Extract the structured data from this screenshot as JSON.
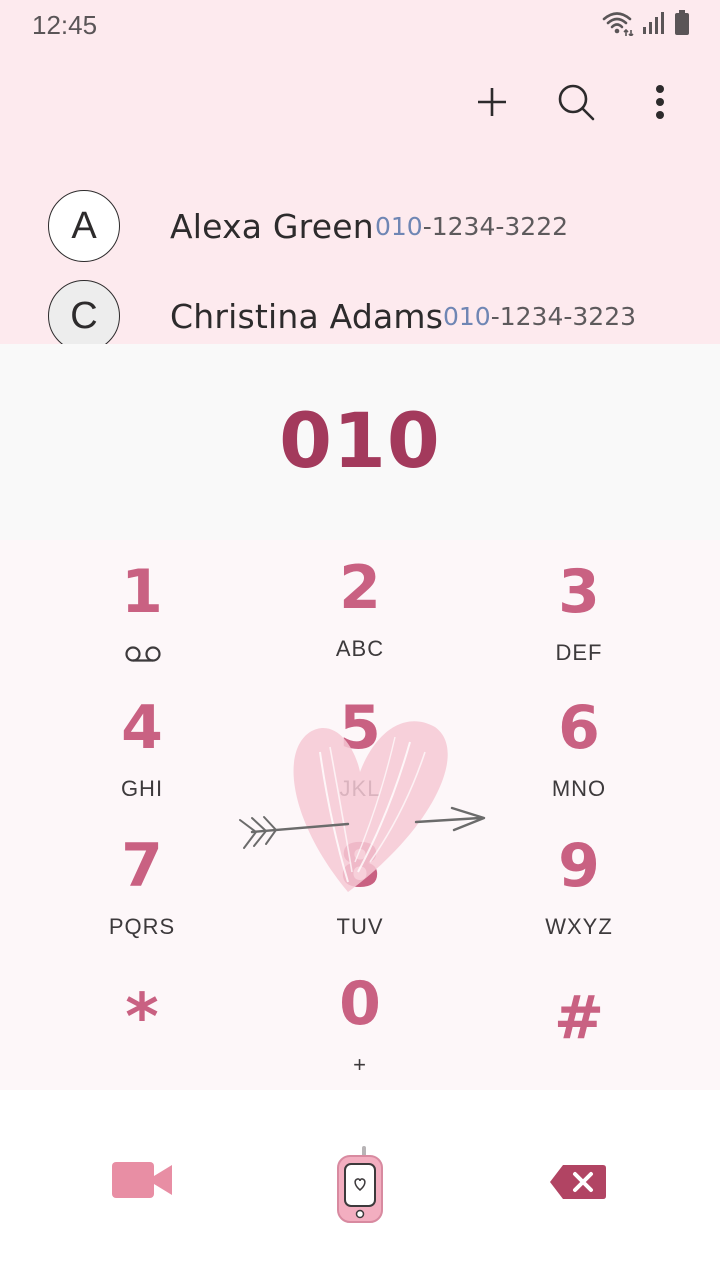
{
  "status_bar": {
    "time": "12:45",
    "icons": [
      "wifi-icon",
      "signal-icon",
      "battery-icon"
    ]
  },
  "toolbar": {
    "actions": [
      "add-contact-icon",
      "search-icon",
      "more-options-icon"
    ]
  },
  "contacts": [
    {
      "initial": "A",
      "name": "Alexa Green",
      "number_match": "010",
      "number_rest": "-1234-3222"
    },
    {
      "initial": "C",
      "name": "Christina Adams",
      "number_match": "010",
      "number_rest": "-1234-3223"
    }
  ],
  "dialer": {
    "entered_number": "010"
  },
  "keypad": {
    "keys": [
      {
        "digit": "1",
        "letters": "",
        "sub_icon": "voicemail-icon"
      },
      {
        "digit": "2",
        "letters": "ABC"
      },
      {
        "digit": "3",
        "letters": "DEF"
      },
      {
        "digit": "4",
        "letters": "GHI"
      },
      {
        "digit": "5",
        "letters": "JKL"
      },
      {
        "digit": "6",
        "letters": "MNO"
      },
      {
        "digit": "7",
        "letters": "PQRS"
      },
      {
        "digit": "8",
        "letters": "TUV"
      },
      {
        "digit": "9",
        "letters": "WXYZ"
      },
      {
        "digit": "*",
        "letters": ""
      },
      {
        "digit": "0",
        "letters": "+"
      },
      {
        "digit": "#",
        "letters": ""
      }
    ]
  },
  "bottom_bar": {
    "actions": [
      "video-call-icon",
      "call-button-phone-icon",
      "backspace-icon"
    ]
  },
  "colors": {
    "accent": "#c96182",
    "number_display": "#a33a5c",
    "match_highlight": "#6f86b4",
    "top_background": "#fdeaee"
  }
}
